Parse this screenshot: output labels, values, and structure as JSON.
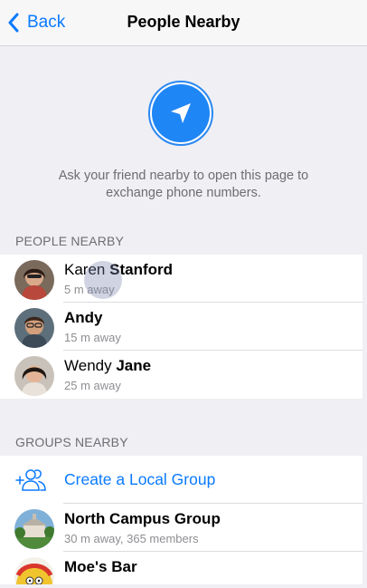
{
  "nav": {
    "back_label": "Back",
    "title": "People Nearby"
  },
  "hero": {
    "icon": "location-arrow-icon",
    "text": "Ask your friend nearby to open this page to exchange phone numbers."
  },
  "people_section": {
    "header": "PEOPLE NEARBY",
    "people": [
      {
        "first": "Karen",
        "last": "Stanford",
        "distance": "5 m away"
      },
      {
        "first": "Andy",
        "last": "",
        "distance": "15 m away"
      },
      {
        "first": "Wendy",
        "last": "Jane",
        "distance": "25 m away"
      }
    ]
  },
  "groups_section": {
    "header": "GROUPS NEARBY",
    "create_label": "Create a Local Group",
    "groups": [
      {
        "name": "North Campus Group",
        "info": "30 m away, 365 members"
      },
      {
        "name": "Moe's Bar",
        "info": ""
      }
    ]
  },
  "colors": {
    "accent": "#0a7aff",
    "background": "#efeff4"
  }
}
